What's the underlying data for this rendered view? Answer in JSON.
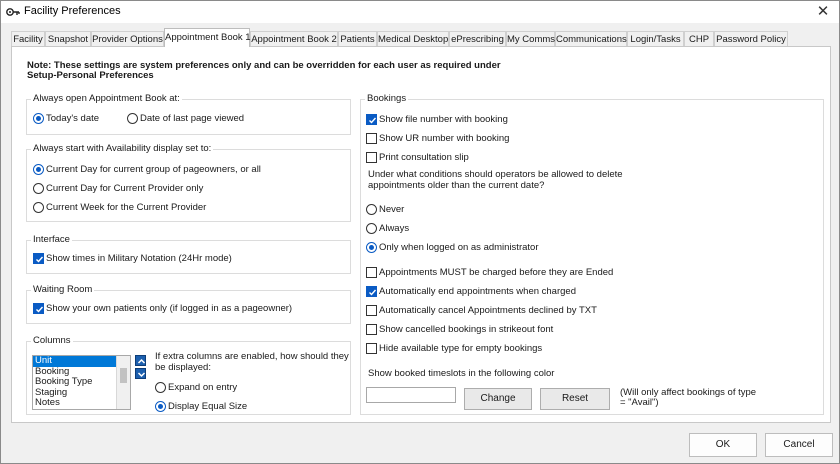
{
  "window": {
    "title": "Facility Preferences",
    "close": "✕"
  },
  "tabs": [
    {
      "label": "Facility"
    },
    {
      "label": "Snapshot"
    },
    {
      "label": "Provider Options"
    },
    {
      "label": "Appointment Book 1"
    },
    {
      "label": "Appointment Book 2"
    },
    {
      "label": "Patients"
    },
    {
      "label": "Medical Desktop"
    },
    {
      "label": "ePrescribing"
    },
    {
      "label": "My Comms"
    },
    {
      "label": "Communications"
    },
    {
      "label": "Login/Tasks"
    },
    {
      "label": "CHP"
    },
    {
      "label": "Password Policy"
    }
  ],
  "active_tab": "Appointment Book 1",
  "note": {
    "line1": "Note: These settings are system preferences only and can be overridden for each user as required under",
    "line2": "Setup-Personal Preferences"
  },
  "always_open": {
    "label": "Always open Appointment Book at:",
    "options": [
      {
        "label": "Today's date",
        "checked": true
      },
      {
        "label": "Date of last page viewed",
        "checked": false
      }
    ]
  },
  "availability": {
    "label": "Always start with Availability display set to:",
    "options": [
      {
        "label": "Current Day for current group of pageowners, or all",
        "checked": true
      },
      {
        "label": "Current Day for Current Provider only",
        "checked": false
      },
      {
        "label": "Current Week for the Current Provider",
        "checked": false
      }
    ]
  },
  "interface": {
    "label": "Interface",
    "military": {
      "label": "Show times in Military Notation (24Hr mode)",
      "checked": true
    }
  },
  "waiting_room": {
    "label": "Waiting Room",
    "own_patients": {
      "label": "Show your own patients only (if logged in as a pageowner)",
      "checked": true
    }
  },
  "columns": {
    "label": "Columns",
    "items": [
      "Unit",
      "Booking",
      "Booking Type",
      "Staging",
      "Notes"
    ],
    "selected": "Unit",
    "question_line1": "If extra columns are enabled, how should they",
    "question_line2": "be displayed:",
    "options": [
      {
        "label": "Expand on entry",
        "checked": false
      },
      {
        "label": "Display Equal Size",
        "checked": true
      }
    ]
  },
  "bookings": {
    "label": "Bookings",
    "top_checks": [
      {
        "label": "Show file number with booking",
        "checked": true
      },
      {
        "label": "Show UR number with booking",
        "checked": false
      },
      {
        "label": "Print consultation slip",
        "checked": false
      }
    ],
    "question_line1": "Under what conditions should operators be allowed to delete",
    "question_line2": "appointments older than the current date?",
    "delete_options": [
      {
        "label": "Never",
        "checked": false
      },
      {
        "label": "Always",
        "checked": false
      },
      {
        "label": "Only when logged on as administrator",
        "checked": true
      }
    ],
    "bottom_checks": [
      {
        "label": "Appointments MUST be charged before they are Ended",
        "checked": false
      },
      {
        "label": "Automatically end appointments when charged",
        "checked": true
      },
      {
        "label": "Automatically cancel Appointments declined by TXT",
        "checked": false
      },
      {
        "label": "Show cancelled bookings in strikeout font",
        "checked": false
      },
      {
        "label": "Hide available type for empty bookings",
        "checked": false
      }
    ],
    "color_label": "Show booked timeslots in the following color",
    "change_label": "Change",
    "reset_label": "Reset",
    "color_note_line1": "(Will only affect bookings of type",
    "color_note_line2": "= \"Avail\")"
  },
  "footer": {
    "ok_label": "OK",
    "cancel_label": "Cancel"
  },
  "colors": {
    "accent": "#0a5bc4",
    "selection": "#0078d7"
  }
}
